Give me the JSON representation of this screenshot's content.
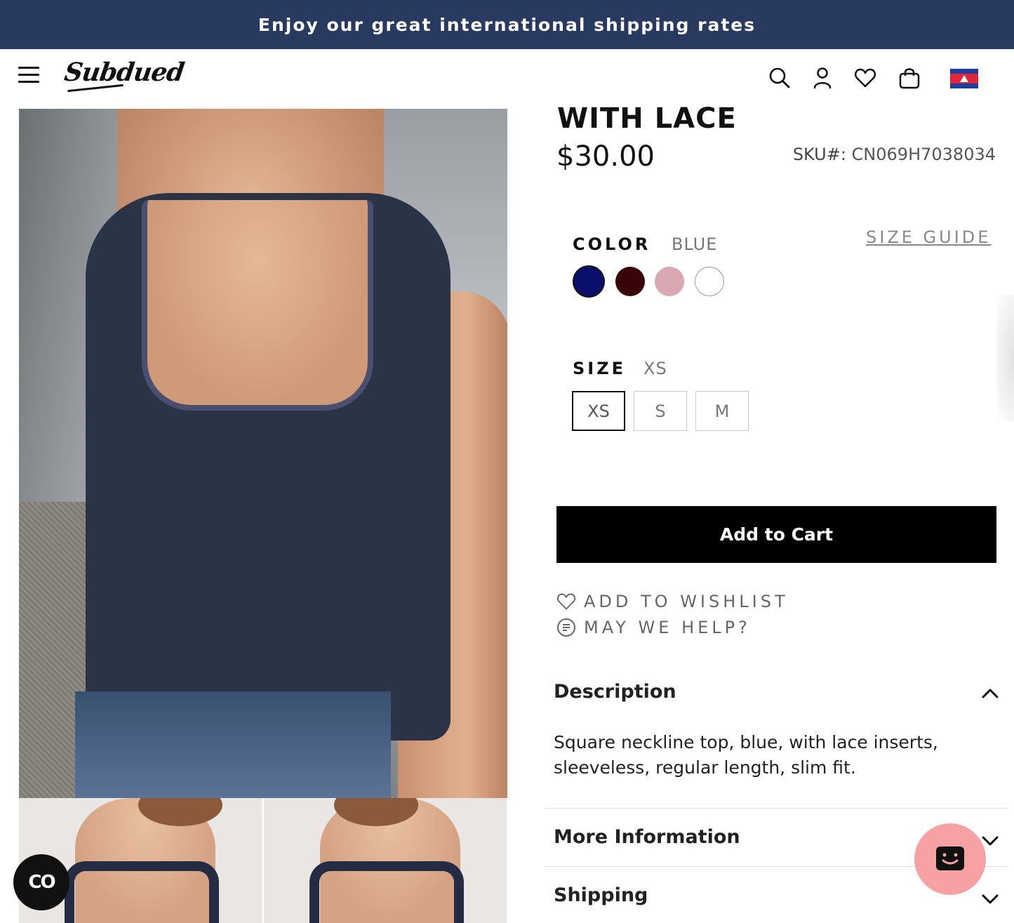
{
  "announcement": "Enjoy our great international shipping rates",
  "header": {
    "logo": "Subdued",
    "icons": [
      "menu-icon",
      "search-icon",
      "account-icon",
      "wishlist-icon",
      "bag-icon",
      "cambodia-flag-icon"
    ]
  },
  "product": {
    "title": "WITH LACE",
    "price": "$30.00",
    "sku_label": "SKU#:",
    "sku_value": "CN069H7038034",
    "color_label": "COLOR",
    "color_value": "BLUE",
    "size_guide": "SIZE GUIDE",
    "colors": [
      {
        "name": "blue",
        "hex": "#0a0f6b",
        "selected": true
      },
      {
        "name": "burgundy",
        "hex": "#3a0508",
        "selected": false
      },
      {
        "name": "pink",
        "hex": "#d9a8b2",
        "selected": false
      },
      {
        "name": "white",
        "hex": "#ffffff",
        "selected": false
      }
    ],
    "size_label": "SIZE",
    "size_value": "XS",
    "sizes": [
      "XS",
      "S",
      "M"
    ],
    "add_to_cart": "Add to Cart",
    "add_to_wishlist": "ADD TO WISHLIST",
    "may_we_help": "MAY WE HELP?"
  },
  "accordion": {
    "description_title": "Description",
    "description_text": "Square neckline top, blue, with lace inserts, sleeveless, regular length, slim fit.",
    "more_info_title": "More Information",
    "shipping_title": "Shipping"
  },
  "chat": {
    "left_label": "CO"
  }
}
